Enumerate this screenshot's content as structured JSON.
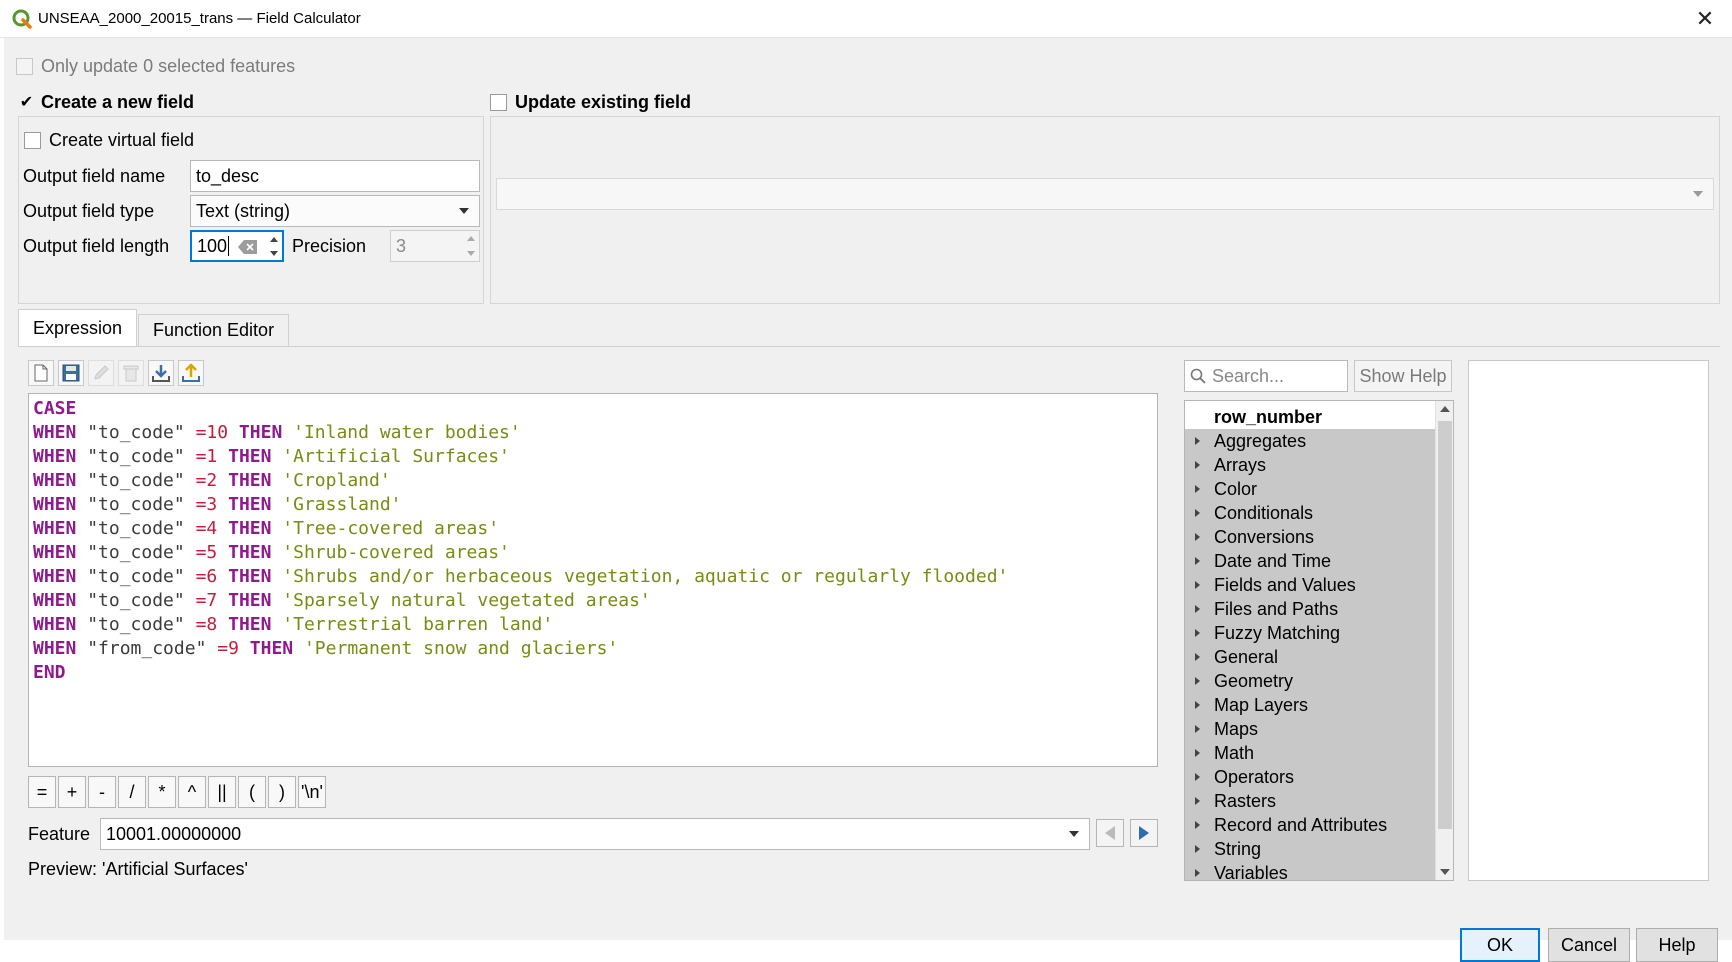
{
  "window": {
    "title": "UNSEAA_2000_20015_trans — Field Calculator",
    "close": "✕"
  },
  "options": {
    "only_update": "Only update 0 selected features",
    "create_new_field": "Create a new field",
    "update_existing_field": "Update existing field",
    "create_virtual_field": "Create virtual field"
  },
  "output": {
    "name_label": "Output field name",
    "name_value": "to_desc",
    "type_label": "Output field type",
    "type_value": "Text (string)",
    "length_label": "Output field length",
    "length_value": "100",
    "precision_label": "Precision",
    "precision_value": "3"
  },
  "tabs": {
    "expression": "Expression",
    "function_editor": "Function Editor"
  },
  "code": {
    "lines": [
      [
        {
          "t": "kw",
          "v": "CASE"
        }
      ],
      [
        {
          "t": "kw",
          "v": "WHEN"
        },
        {
          "t": "fld",
          "v": " \"to_code\" "
        },
        {
          "t": "op",
          "v": "=10"
        },
        {
          "t": "kw",
          "v": " THEN "
        },
        {
          "t": "str",
          "v": "'Inland water bodies'"
        }
      ],
      [
        {
          "t": "kw",
          "v": "WHEN"
        },
        {
          "t": "fld",
          "v": " \"to_code\" "
        },
        {
          "t": "op",
          "v": "=1"
        },
        {
          "t": "kw",
          "v": " THEN "
        },
        {
          "t": "str",
          "v": "'Artificial Surfaces'"
        }
      ],
      [
        {
          "t": "kw",
          "v": "WHEN"
        },
        {
          "t": "fld",
          "v": " \"to_code\" "
        },
        {
          "t": "op",
          "v": "=2"
        },
        {
          "t": "kw",
          "v": " THEN "
        },
        {
          "t": "str",
          "v": "'Cropland'"
        }
      ],
      [
        {
          "t": "kw",
          "v": "WHEN"
        },
        {
          "t": "fld",
          "v": " \"to_code\" "
        },
        {
          "t": "op",
          "v": "=3"
        },
        {
          "t": "kw",
          "v": " THEN "
        },
        {
          "t": "str",
          "v": "'Grassland'"
        }
      ],
      [
        {
          "t": "kw",
          "v": "WHEN"
        },
        {
          "t": "fld",
          "v": " \"to_code\" "
        },
        {
          "t": "op",
          "v": "=4"
        },
        {
          "t": "kw",
          "v": " THEN "
        },
        {
          "t": "str",
          "v": "'Tree-covered areas'"
        }
      ],
      [
        {
          "t": "kw",
          "v": "WHEN"
        },
        {
          "t": "fld",
          "v": " \"to_code\" "
        },
        {
          "t": "op",
          "v": "=5"
        },
        {
          "t": "kw",
          "v": " THEN "
        },
        {
          "t": "str",
          "v": "'Shrub-covered areas'"
        }
      ],
      [
        {
          "t": "kw",
          "v": "WHEN"
        },
        {
          "t": "fld",
          "v": " \"to_code\" "
        },
        {
          "t": "op",
          "v": "=6"
        },
        {
          "t": "kw",
          "v": " THEN "
        },
        {
          "t": "str",
          "v": "'Shrubs and/or herbaceous vegetation, aquatic or regularly flooded'"
        }
      ],
      [
        {
          "t": "kw",
          "v": "WHEN"
        },
        {
          "t": "fld",
          "v": " \"to_code\" "
        },
        {
          "t": "op",
          "v": "=7"
        },
        {
          "t": "kw",
          "v": " THEN "
        },
        {
          "t": "str",
          "v": "'Sparsely natural vegetated areas'"
        }
      ],
      [
        {
          "t": "kw",
          "v": "WHEN"
        },
        {
          "t": "fld",
          "v": " \"to_code\" "
        },
        {
          "t": "op",
          "v": "=8"
        },
        {
          "t": "kw",
          "v": " THEN "
        },
        {
          "t": "str",
          "v": "'Terrestrial barren land'"
        }
      ],
      [
        {
          "t": "kw",
          "v": "WHEN"
        },
        {
          "t": "fld",
          "v": " \"from_code\" "
        },
        {
          "t": "op",
          "v": "=9"
        },
        {
          "t": "kw",
          "v": " THEN "
        },
        {
          "t": "str",
          "v": "'Permanent snow and glaciers'"
        }
      ],
      [
        {
          "t": "kw",
          "v": "END"
        }
      ]
    ]
  },
  "operators": [
    "=",
    "+",
    "-",
    "/",
    "*",
    "^",
    "||",
    "(",
    ")",
    "'\\n'"
  ],
  "feature": {
    "label": "Feature",
    "value": "10001.00000000"
  },
  "preview": "Preview: 'Artificial Surfaces'",
  "search": {
    "placeholder": "Search..."
  },
  "show_help": "Show Help",
  "functions": [
    "row_number",
    "Aggregates",
    "Arrays",
    "Color",
    "Conditionals",
    "Conversions",
    "Date and Time",
    "Fields and Values",
    "Files and Paths",
    "Fuzzy Matching",
    "General",
    "Geometry",
    "Map Layers",
    "Maps",
    "Math",
    "Operators",
    "Rasters",
    "Record and Attributes",
    "String",
    "Variables"
  ],
  "buttons": {
    "ok": "OK",
    "cancel": "Cancel",
    "help": "Help"
  },
  "colors": {
    "keyword": "#8e1a8e",
    "operator": "#c0203c",
    "string": "#7a8a14",
    "accent": "#0078d7"
  }
}
